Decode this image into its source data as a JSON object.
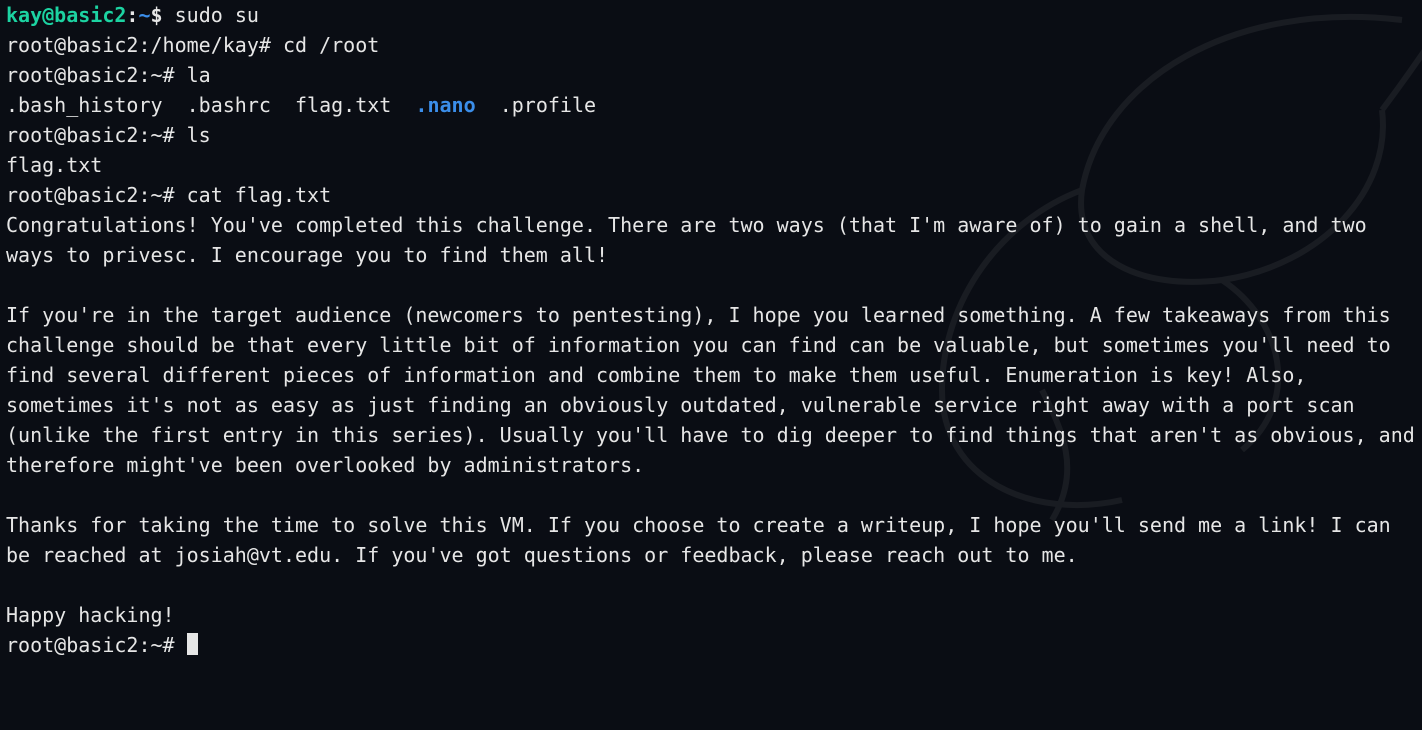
{
  "lines": [
    {
      "segments": [
        {
          "text": "kay@basic2",
          "cls": "bold green"
        },
        {
          "text": ":",
          "cls": "bold white"
        },
        {
          "text": "~",
          "cls": "bold blue"
        },
        {
          "text": "$ ",
          "cls": "bold white"
        },
        {
          "text": "sudo su",
          "cls": "white"
        }
      ]
    },
    {
      "segments": [
        {
          "text": "root@basic2:/home/kay# cd /root",
          "cls": "white"
        }
      ]
    },
    {
      "segments": [
        {
          "text": "root@basic2:~# la",
          "cls": "white"
        }
      ]
    },
    {
      "segments": [
        {
          "text": ".bash_history  .bashrc  flag.txt  ",
          "cls": "white"
        },
        {
          "text": ".nano",
          "cls": "bold blue"
        },
        {
          "text": "  .profile",
          "cls": "white"
        }
      ]
    },
    {
      "segments": [
        {
          "text": "root@basic2:~# ls",
          "cls": "white"
        }
      ]
    },
    {
      "segments": [
        {
          "text": "flag.txt",
          "cls": "white"
        }
      ]
    },
    {
      "segments": [
        {
          "text": "root@basic2:~# cat flag.txt",
          "cls": "white"
        }
      ]
    },
    {
      "segments": [
        {
          "text": "Congratulations! You've completed this challenge. There are two ways (that I'm aware of) to gain a shell, and two ways to privesc. I encourage you to find them all!",
          "cls": "white"
        }
      ]
    },
    {
      "segments": [
        {
          "text": "",
          "cls": "white"
        }
      ]
    },
    {
      "segments": [
        {
          "text": "If you're in the target audience (newcomers to pentesting), I hope you learned something. A few takeaways from this challenge should be that every little bit of information you can find can be valuable, but sometimes you'll need to find several different pieces of information and combine them to make them useful. Enumeration is key! Also, sometimes it's not as easy as just finding an obviously outdated, vulnerable service right away with a port scan (unlike the first entry in this series). Usually you'll have to dig deeper to find things that aren't as obvious, and therefore might've been overlooked by administrators.",
          "cls": "white"
        }
      ]
    },
    {
      "segments": [
        {
          "text": "",
          "cls": "white"
        }
      ]
    },
    {
      "segments": [
        {
          "text": "Thanks for taking the time to solve this VM. If you choose to create a writeup, I hope you'll send me a link! I can be reached at josiah@vt.edu. If you've got questions or feedback, please reach out to me.",
          "cls": "white"
        }
      ]
    },
    {
      "segments": [
        {
          "text": "",
          "cls": "white"
        }
      ]
    },
    {
      "segments": [
        {
          "text": "Happy hacking!",
          "cls": "white"
        }
      ]
    },
    {
      "segments": [
        {
          "text": "root@basic2:~# ",
          "cls": "white"
        }
      ],
      "cursor": true
    }
  ]
}
